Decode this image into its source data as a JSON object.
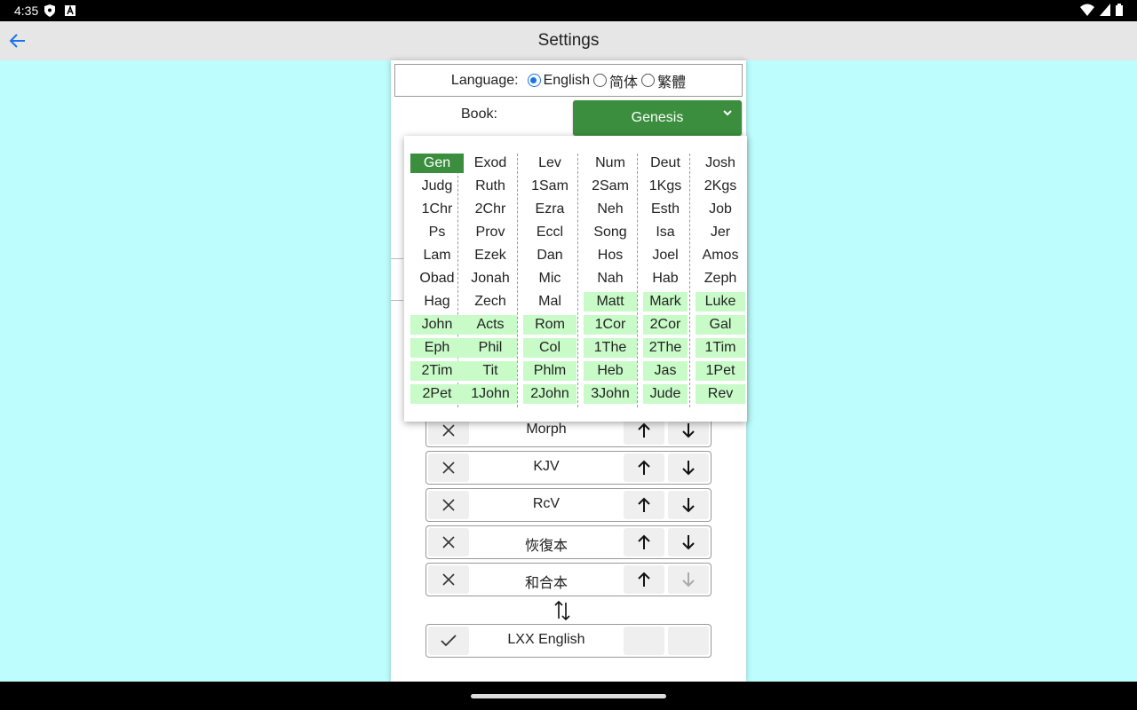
{
  "status": {
    "time": "4:35"
  },
  "appbar": {
    "title": "Settings"
  },
  "language": {
    "label": "Language:",
    "options": [
      "English",
      "简体",
      "繁體"
    ],
    "selected": "English"
  },
  "book": {
    "label": "Book:",
    "selected": "Genesis"
  },
  "books": [
    [
      "Gen",
      "Exod",
      "Lev",
      "Num",
      "Deut",
      "Josh"
    ],
    [
      "Judg",
      "Ruth",
      "1Sam",
      "2Sam",
      "1Kgs",
      "2Kgs"
    ],
    [
      "1Chr",
      "2Chr",
      "Ezra",
      "Neh",
      "Esth",
      "Job"
    ],
    [
      "Ps",
      "Prov",
      "Eccl",
      "Song",
      "Isa",
      "Jer"
    ],
    [
      "Lam",
      "Ezek",
      "Dan",
      "Hos",
      "Joel",
      "Amos"
    ],
    [
      "Obad",
      "Jonah",
      "Mic",
      "Nah",
      "Hab",
      "Zeph"
    ],
    [
      "Hag",
      "Zech",
      "Mal",
      "Matt",
      "Mark",
      "Luke"
    ],
    [
      "John",
      "Acts",
      "Rom",
      "1Cor",
      "2Cor",
      "Gal"
    ],
    [
      "Eph",
      "Phil",
      "Col",
      "1The",
      "2The",
      "1Tim"
    ],
    [
      "2Tim",
      "Tit",
      "Phlm",
      "Heb",
      "Jas",
      "1Pet"
    ],
    [
      "2Pet",
      "1John",
      "2John",
      "3John",
      "Jude",
      "Rev"
    ]
  ],
  "selected_book": "Gen",
  "nt_start_index": 39,
  "colors": {
    "accent": "#3b8e3e",
    "nt_highlight": "#c8fbc8",
    "background": "#bdfdfd",
    "link": "#1a73e8"
  },
  "versions": [
    {
      "name": "Morph",
      "icon": "close-icon",
      "up": true,
      "down": true
    },
    {
      "name": "KJV",
      "icon": "close-icon",
      "up": true,
      "down": true
    },
    {
      "name": "RcV",
      "icon": "close-icon",
      "up": true,
      "down": true
    },
    {
      "name": "恢復本",
      "icon": "close-icon",
      "up": true,
      "down": true
    },
    {
      "name": "和合本",
      "icon": "close-icon",
      "up": true,
      "down": false
    }
  ],
  "extra_version": {
    "name": "LXX English",
    "icon": "check-icon"
  }
}
